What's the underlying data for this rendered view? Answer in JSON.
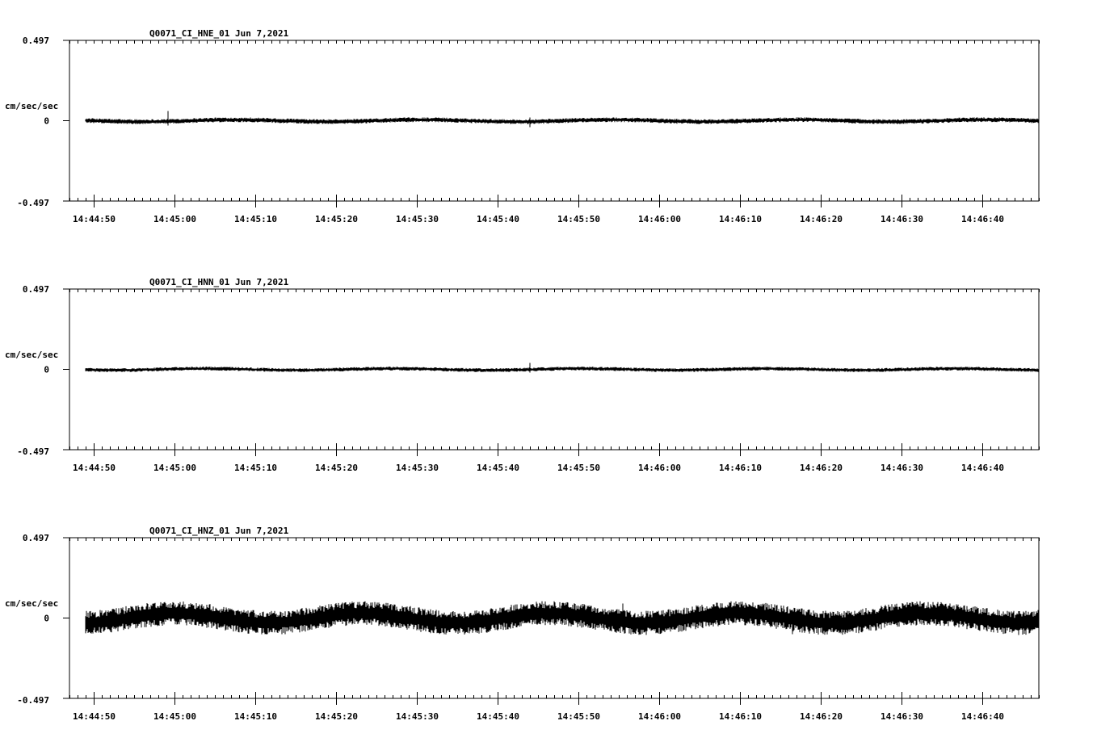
{
  "chart_data": [
    {
      "type": "line",
      "title": "Q0071_CI_HNE_01  Jun 7,2021",
      "ylabel": "cm/sec/sec",
      "ylim": [
        -0.497,
        0.497
      ],
      "y_tick_labels": [
        "0.497",
        "0",
        "-0.497"
      ],
      "x_tick_labels": [
        "14:44:50",
        "14:45:00",
        "14:45:10",
        "14:45:20",
        "14:45:30",
        "14:45:40",
        "14:45:50",
        "14:46:00",
        "14:46:10",
        "14:46:20",
        "14:46:30",
        "14:46:40"
      ],
      "x_range": [
        "14:44:47",
        "14:46:47"
      ],
      "data_start": "14:44:49",
      "noise_amplitude": 0.01,
      "spikes": [
        {
          "t": "14:44:59.2",
          "value": 0.06
        },
        {
          "t": "14:45:44",
          "value": -0.04
        }
      ],
      "grid": false
    },
    {
      "type": "line",
      "title": "Q0071_CI_HNN_01  Jun 7,2021",
      "ylabel": "cm/sec/sec",
      "ylim": [
        -0.497,
        0.497
      ],
      "y_tick_labels": [
        "0.497",
        "0",
        "-0.497"
      ],
      "x_tick_labels": [
        "14:44:50",
        "14:45:00",
        "14:45:10",
        "14:45:20",
        "14:45:30",
        "14:45:40",
        "14:45:50",
        "14:46:00",
        "14:46:10",
        "14:46:20",
        "14:46:30",
        "14:46:40"
      ],
      "x_range": [
        "14:44:47",
        "14:46:47"
      ],
      "data_start": "14:44:49",
      "noise_amplitude": 0.008,
      "spikes": [
        {
          "t": "14:45:44",
          "value": 0.04
        }
      ],
      "grid": false
    },
    {
      "type": "line",
      "title": "Q0071_CI_HNZ_01  Jun 7,2021",
      "ylabel": "cm/sec/sec",
      "ylim": [
        -0.497,
        0.497
      ],
      "y_tick_labels": [
        "0.497",
        "0",
        "-0.497"
      ],
      "x_tick_labels": [
        "14:44:50",
        "14:45:00",
        "14:45:10",
        "14:45:20",
        "14:45:30",
        "14:45:40",
        "14:45:50",
        "14:46:00",
        "14:46:10",
        "14:46:20",
        "14:46:30",
        "14:46:40"
      ],
      "x_range": [
        "14:44:47",
        "14:46:47"
      ],
      "data_start": "14:44:49",
      "noise_amplitude": 0.05,
      "spikes": [
        {
          "t": "14:45:55.5",
          "value": 0.09
        },
        {
          "t": "14:46:16.5",
          "value": -0.1
        }
      ],
      "grid": false
    }
  ]
}
